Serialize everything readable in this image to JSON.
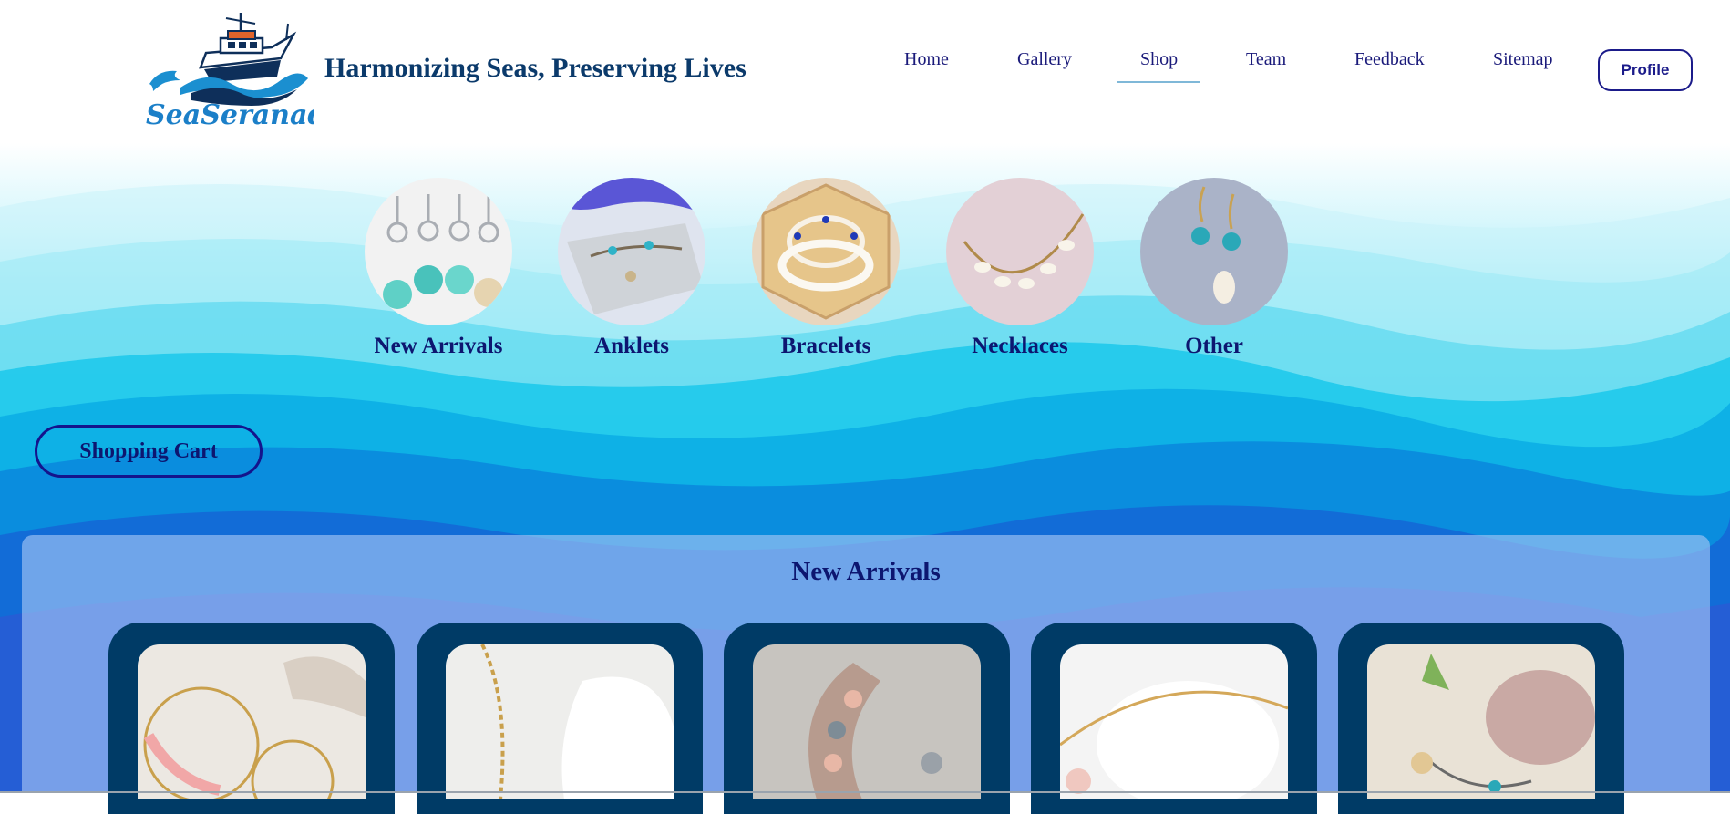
{
  "header": {
    "logo_text": "SeaSeranade",
    "tagline": "Harmonizing Seas, Preserving Lives"
  },
  "nav": {
    "items": [
      {
        "label": "Home",
        "active": false
      },
      {
        "label": "Gallery",
        "active": false
      },
      {
        "label": "Shop",
        "active": true
      },
      {
        "label": "Team",
        "active": false
      },
      {
        "label": "Feedback",
        "active": false
      },
      {
        "label": "Sitemap",
        "active": false
      }
    ],
    "profile_label": "Profile"
  },
  "categories": [
    {
      "label": "New Arrivals",
      "image": "seashell-keychains"
    },
    {
      "label": "Anklets",
      "image": "starfish-anklet"
    },
    {
      "label": "Bracelets",
      "image": "cowrie-bracelets"
    },
    {
      "label": "Necklaces",
      "image": "shell-necklace"
    },
    {
      "label": "Other",
      "image": "turquoise-earrings"
    }
  ],
  "cart": {
    "label": "Shopping Cart"
  },
  "new_arrivals": {
    "title": "New Arrivals",
    "products": [
      {
        "image": "pink-coral-hoop-earrings"
      },
      {
        "image": "gold-chain-necklace"
      },
      {
        "image": "seashell-crescent-moon"
      },
      {
        "image": "gold-shell-bracelet"
      },
      {
        "image": "beach-charm-bracelet"
      }
    ]
  },
  "colors": {
    "brand_navy": "#0d1670",
    "card_navy": "#003b66",
    "ocean_light": "#a8eef8",
    "ocean_deep": "#1468d8"
  }
}
